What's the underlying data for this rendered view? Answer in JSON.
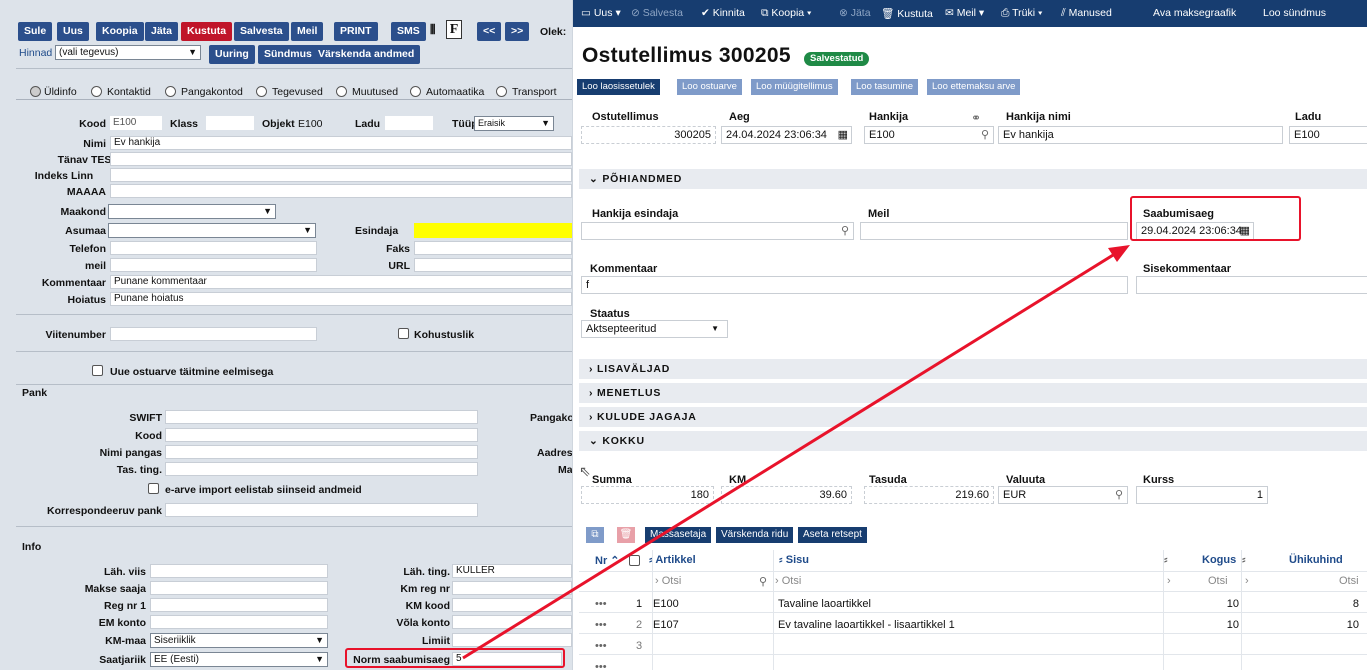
{
  "left": {
    "toolbar": [
      "Sule",
      "Uus",
      "Koopia",
      "Jäta",
      "Kustuta",
      "Salvesta",
      "Meil",
      "PRINT",
      "SMS",
      "<<",
      ">>"
    ],
    "toolbar_f": "F",
    "toolbar_olek": "Olek:",
    "hinnad_label": "Hinnad",
    "hinnad_value": "(vali tegevus)",
    "row2_buttons": [
      "Uuring",
      "Sündmus",
      "Värskenda andmed"
    ],
    "tabs": [
      "Üldinfo",
      "Kontaktid",
      "Pangakontod",
      "Tegevused",
      "Muutused",
      "Automaatika",
      "Transport"
    ],
    "kood_label": "Kood",
    "kood_value": "E100",
    "klass_label": "Klass",
    "objekt_label": "Objekt",
    "objekt_value": "E100",
    "ladu_label": "Ladu",
    "tyyp_label": "Tüüp",
    "tyyp_value": "Eraisik",
    "nimi_label": "Nimi",
    "nimi_value": "Ev hankija",
    "tanav_label": "Tänav",
    "tanav_value": "TEST",
    "indeks_label": "Indeks",
    "linn_label": "Linn",
    "maaaa_label": "MAAAA",
    "maakond_label": "Maakond",
    "asumaa_label": "Asumaa",
    "esindaja_label": "Esindaja",
    "telefon_label": "Telefon",
    "faks_label": "Faks",
    "meil_label": "meil",
    "url_label": "URL",
    "kommentaar_label": "Kommentaar",
    "kommentaar_value": "Punane kommentaar",
    "hoiatus_label": "Hoiatus",
    "hoiatus_value": "Punane hoiatus",
    "viitenumber_label": "Viitenumber",
    "kohustuslik_label": "Kohustuslik",
    "uue_ostuarve_label": "Uue ostuarve täitmine eelmisega",
    "pank_section": "Pank",
    "swift_label": "SWIFT",
    "pangako_label": "Pangako",
    "kood2_label": "Kood",
    "nimi_pangas_label": "Nimi pangas",
    "aadres_label": "Aadres",
    "tas_ting_label": "Tas. ting.",
    "ma_label": "Ma",
    "earve_label": "e-arve import eelistab siinseid andmeid",
    "korrespondeeruv_label": "Korrespondeeruv pank",
    "info_section": "Info",
    "lah_viis_label": "Läh. viis",
    "lah_ting_label": "Läh. ting.",
    "lah_ting_value": "KULLER",
    "makse_saaja_label": "Makse saaja",
    "km_reg_label": "Km reg nr",
    "reg_nr_label": "Reg nr 1",
    "km_kood_label": "KM kood",
    "em_konto_label": "EM konto",
    "vola_konto_label": "Võla konto",
    "km_maa_label": "KM-maa",
    "km_maa_value": "Siseriiklik",
    "limiit_label": "Limiit",
    "saatjariik_label": "Saatjariik",
    "saatjariik_value": "EE (Eesti)",
    "norm_label": "Norm saabumisaeg",
    "norm_value": "5"
  },
  "right": {
    "topbar": [
      "Uus",
      "Salvesta",
      "Kinnita",
      "Koopia",
      "Jäta",
      "Kustuta",
      "Meil",
      "Trüki",
      "Manused",
      "Ava maksegraafik",
      "Loo sündmus"
    ],
    "title": "Ostutellimus 300205",
    "status_badge": "Salvestatud",
    "tabs": [
      "Loo laosissetulek",
      "Loo ostuarve",
      "Loo müügitellimus",
      "Loo tasumine",
      "Loo ettemaksu arve"
    ],
    "ostutellimus_label": "Ostutellimus",
    "ostutellimus_value": "300205",
    "aeg_label": "Aeg",
    "aeg_value": "24.04.2024 23:06:34",
    "hankija_label": "Hankija",
    "hankija_value": "E100",
    "hankija_nimi_label": "Hankija nimi",
    "hankija_nimi_value": "Ev hankija",
    "ladu_label": "Ladu",
    "ladu_value": "E100",
    "sec_pohiandmed": "PÕHIANDMED",
    "hankija_esindaja_label": "Hankija esindaja",
    "meil_label": "Meil",
    "saabumisaeg_label": "Saabumisaeg",
    "saabumisaeg_value": "29.04.2024 23:06:34",
    "kommentaar_label": "Kommentaar",
    "kommentaar_value": "f",
    "sisekommentaar_label": "Sisekommentaar",
    "staatus_label": "Staatus",
    "staatus_value": "Aktsepteeritud",
    "sec_lisavaljad": "LISAVÄLJAD",
    "sec_menetlus": "MENETLUS",
    "sec_kulude": "KULUDE JAGAJA",
    "sec_kokku": "KOKKU",
    "summa_label": "Summa",
    "summa_value": "180",
    "km_label": "KM",
    "km_value": "39.60",
    "tasuda_label": "Tasuda",
    "tasuda_value": "219.60",
    "valuuta_label": "Valuuta",
    "valuuta_value": "EUR",
    "kurss_label": "Kurss",
    "kurss_value": "1",
    "grid_buttons": [
      "Massasetaja",
      "Värskenda ridu",
      "Aseta retsept"
    ],
    "col_nr": "Nr",
    "col_artikkel": "Artikkel",
    "col_sisu": "Sisu",
    "col_kogus": "Kogus",
    "col_uhikuhind": "Ühikuhind",
    "filter_placeholder": "Otsi",
    "rows": [
      {
        "nr": "1",
        "artikkel": "E100",
        "sisu": "Tavaline laoartikkel",
        "kogus": "10",
        "hind": "8"
      },
      {
        "nr": "2",
        "artikkel": "E107",
        "sisu": "Ev tavaline laoartikkel - lisaartikkel 1",
        "kogus": "10",
        "hind": "10"
      },
      {
        "nr": "3",
        "artikkel": "",
        "sisu": "",
        "kogus": "",
        "hind": ""
      }
    ]
  },
  "colors": {
    "highlight": "#e8132b",
    "nav": "#173d70",
    "badge": "#1f8a46",
    "yellow": "#ffff00"
  }
}
